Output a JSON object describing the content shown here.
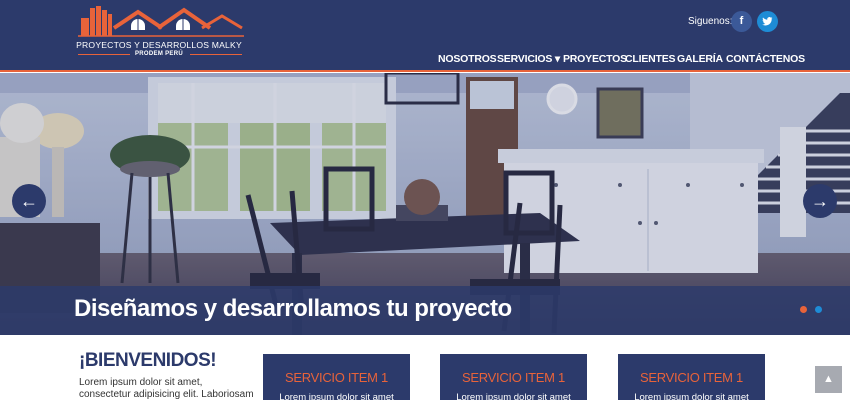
{
  "brand": {
    "name": "PROYECTOS Y DESARROLLOS MALKY",
    "tagline": "PRODEM PERÚ"
  },
  "header": {
    "follow_label": "Siguenos:",
    "social": [
      {
        "name": "facebook",
        "glyph": "f"
      },
      {
        "name": "twitter",
        "glyph": "t"
      }
    ]
  },
  "nav": {
    "items": [
      {
        "label": "NOSOTROS"
      },
      {
        "label": "SERVICIOS ▾"
      },
      {
        "label": "PROYECTOS"
      },
      {
        "label": "CLIENTES"
      },
      {
        "label": "GALERÍA"
      },
      {
        "label": "CONTÁCTENOS"
      }
    ]
  },
  "hero": {
    "caption": "Diseñamos y desarrollamos tu proyecto",
    "prev_glyph": "←",
    "next_glyph": "→",
    "active_slide": 1,
    "slide_count": 2
  },
  "welcome": {
    "title": "¡BIENVENIDOS!",
    "body": "Lorem ipsum dolor sit amet, consectetur adipisicing elit. Laboriosam"
  },
  "services": [
    {
      "title": "SERVICIO ITEM 1",
      "text": "Lorem ipsum dolor sit amet"
    },
    {
      "title": "SERVICIO ITEM 1",
      "text": "Lorem ipsum dolor sit amet"
    },
    {
      "title": "SERVICIO ITEM 1",
      "text": "Lorem ipsum dolor sit amet"
    }
  ],
  "scroll_top": {
    "glyph": "▲"
  },
  "colors": {
    "primary": "#2c3a6b",
    "accent": "#e8633a",
    "social_twitter": "#1e8cd6",
    "social_facebook": "#3b5998"
  }
}
